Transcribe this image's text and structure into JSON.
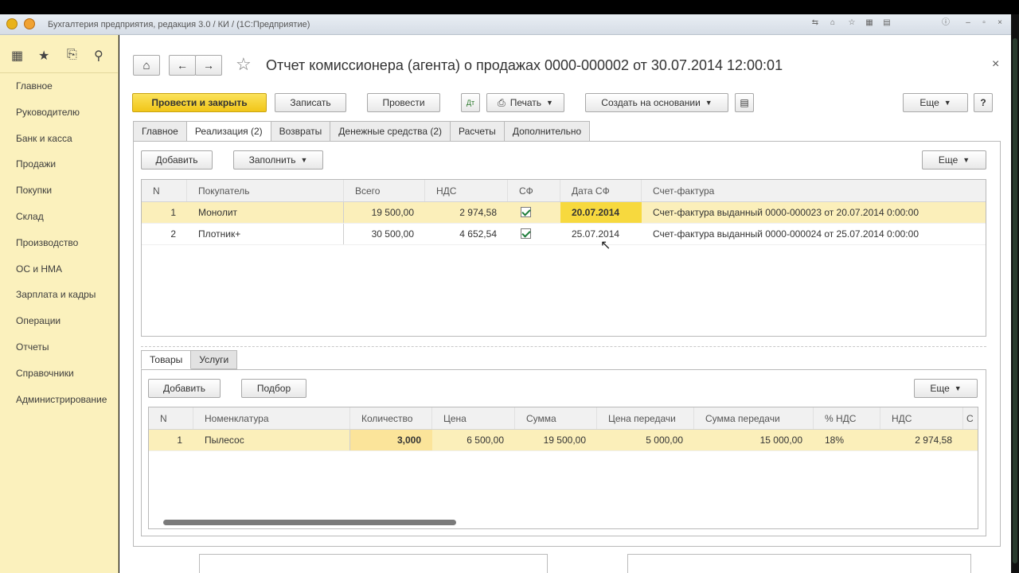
{
  "window": {
    "app_title": "Бухгалтерия предприятия, редакция 3.0 / КИ / (1С:Предприятие)"
  },
  "sidebar": {
    "items": [
      {
        "label": "Главное"
      },
      {
        "label": "Руководителю"
      },
      {
        "label": "Банк и касса"
      },
      {
        "label": "Продажи"
      },
      {
        "label": "Покупки"
      },
      {
        "label": "Склад"
      },
      {
        "label": "Производство"
      },
      {
        "label": "ОС и НМА"
      },
      {
        "label": "Зарплата и кадры"
      },
      {
        "label": "Операции"
      },
      {
        "label": "Отчеты"
      },
      {
        "label": "Справочники"
      },
      {
        "label": "Администрирование"
      }
    ]
  },
  "header": {
    "title": "Отчет комиссионера (агента) о продажах 0000-000002 от 30.07.2014 12:00:01",
    "close": "×"
  },
  "toolbar": {
    "post_close": "Провести и закрыть",
    "save": "Записать",
    "post": "Провести",
    "print": "Печать",
    "create_based": "Создать на основании",
    "more": "Еще",
    "help": "?"
  },
  "tabs": [
    {
      "label": "Главное"
    },
    {
      "label": "Реализация (2)"
    },
    {
      "label": "Возвраты"
    },
    {
      "label": "Денежные средства (2)"
    },
    {
      "label": "Расчеты"
    },
    {
      "label": "Дополнительно"
    }
  ],
  "sales": {
    "add": "Добавить",
    "fill": "Заполнить",
    "more": "Еще",
    "columns": [
      "N",
      "Покупатель",
      "Всего",
      "НДС",
      "СФ",
      "Дата СФ",
      "Счет-фактура"
    ],
    "rows": [
      {
        "n": "1",
        "buyer": "Монолит",
        "total": "19 500,00",
        "vat": "2 974,58",
        "inv_date": "20.07.2014",
        "invoice": "Счет-фактура выданный 0000-000023 от 20.07.2014 0:00:00"
      },
      {
        "n": "2",
        "buyer": "Плотник+",
        "total": "30 500,00",
        "vat": "4 652,54",
        "inv_date": "25.07.2014",
        "invoice": "Счет-фактура выданный 0000-000024 от 25.07.2014 0:00:00"
      }
    ]
  },
  "subtabs": [
    {
      "label": "Товары"
    },
    {
      "label": "Услуги"
    }
  ],
  "goods": {
    "add": "Добавить",
    "pick": "Подбор",
    "more": "Еще",
    "columns": [
      "N",
      "Номенклатура",
      "Количество",
      "Цена",
      "Сумма",
      "Цена передачи",
      "Сумма передачи",
      "% НДС",
      "НДС",
      "С"
    ],
    "rows": [
      {
        "n": "1",
        "item": "Пылесос",
        "qty": "3,000",
        "price": "6 500,00",
        "sum": "19 500,00",
        "tprice": "5 000,00",
        "tsum": "15 000,00",
        "vat_rate": "18%",
        "vat": "2 974,58"
      }
    ]
  },
  "colors": {
    "accent": "#f1c619",
    "sidebar_bg": "#fbf1bd",
    "selected_row": "#fbefba",
    "highlight_cell": "#f7d93e"
  }
}
